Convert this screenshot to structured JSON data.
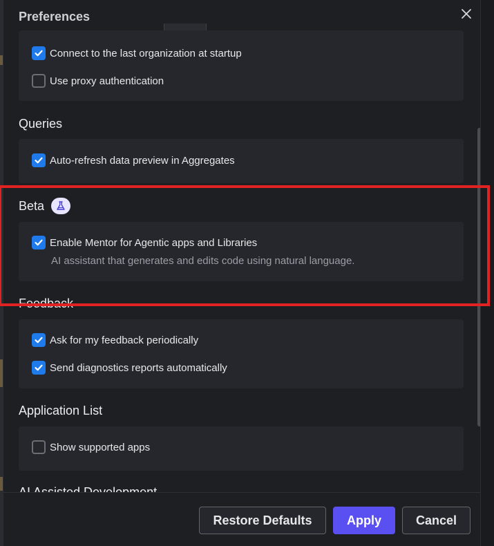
{
  "dialog": {
    "title": "Preferences",
    "close_icon": "close-icon"
  },
  "sections": {
    "general_items": [
      {
        "label": "Connect to the last organization at startup",
        "checked": true
      },
      {
        "label": "Use proxy authentication",
        "checked": false
      }
    ],
    "queries": {
      "title": "Queries",
      "items": [
        {
          "label": "Auto-refresh data preview in Aggregates",
          "checked": true
        }
      ]
    },
    "beta": {
      "title": "Beta",
      "badge_icon": "flask-icon",
      "items": [
        {
          "label": "Enable Mentor for Agentic apps and Libraries",
          "checked": true,
          "description": "AI assistant that generates and edits code using natural language."
        }
      ]
    },
    "feedback": {
      "title": "Feedback",
      "items": [
        {
          "label": "Ask for my feedback periodically",
          "checked": true
        },
        {
          "label": "Send diagnostics reports automatically",
          "checked": true
        }
      ]
    },
    "application_list": {
      "title": "Application List",
      "items": [
        {
          "label": "Show supported apps",
          "checked": false
        }
      ]
    },
    "ai_assisted": {
      "title": "AI Assisted Development"
    }
  },
  "footer": {
    "restore_label": "Restore Defaults",
    "apply_label": "Apply",
    "cancel_label": "Cancel"
  },
  "colors": {
    "accent": "#5a4ff0",
    "checkbox": "#1f7aec",
    "highlight": "#e02222"
  }
}
